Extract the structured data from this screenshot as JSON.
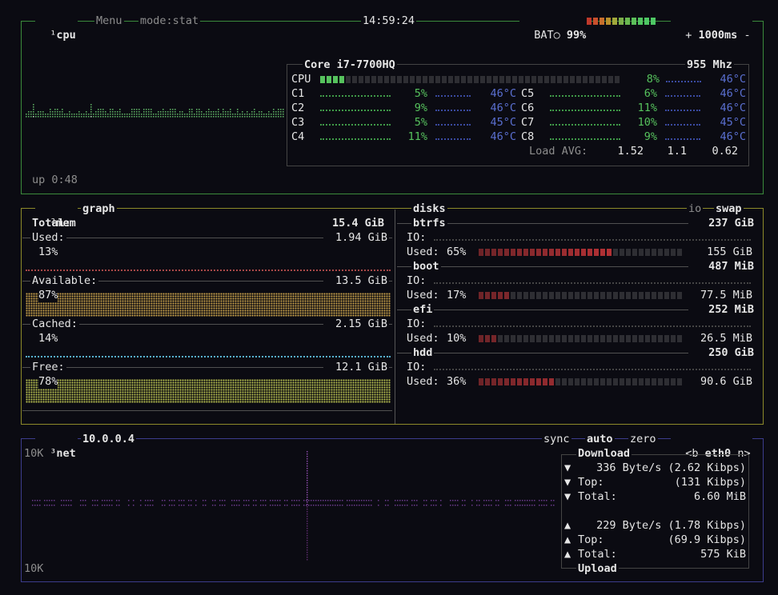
{
  "colors": {
    "cpu_border": "#3b8a3b",
    "mem_border": "#8d8a2a",
    "net_border": "#3c3c8c",
    "cpu_green": "#56c25d",
    "temp_blue": "#5a6fd0",
    "mem_used": "#c05050",
    "mem_avail": "#c8a24a",
    "mem_cached": "#58b0d0",
    "mem_free": "#b8c050",
    "disk_used": "#c0404a",
    "net_graph": "#6a3a8a"
  },
  "cpu": {
    "tab_num": "¹",
    "tab": "cpu",
    "menu": "Menu",
    "mode": "mode:stat",
    "clock": "14:59:24",
    "battery_label": "BAT○",
    "battery_pct": "99%",
    "battery_level": 0.99,
    "plus": "+",
    "interval": "1000ms",
    "minus": "-",
    "uptime": "up 0:48",
    "model": "Core i7-7700HQ",
    "freq": "955 Mhz",
    "total_label": "CPU",
    "total_pct": "8%",
    "total_level": 0.08,
    "total_temp": "46°C",
    "cores": [
      {
        "name": "C1",
        "pct": "5%",
        "temp": "46°C"
      },
      {
        "name": "C2",
        "pct": "9%",
        "temp": "46°C"
      },
      {
        "name": "C3",
        "pct": "5%",
        "temp": "45°C"
      },
      {
        "name": "C4",
        "pct": "11%",
        "temp": "46°C"
      },
      {
        "name": "C5",
        "pct": "6%",
        "temp": "46°C"
      },
      {
        "name": "C6",
        "pct": "11%",
        "temp": "46°C"
      },
      {
        "name": "C7",
        "pct": "10%",
        "temp": "45°C"
      },
      {
        "name": "C8",
        "pct": "9%",
        "temp": "46°C"
      }
    ],
    "load_label": "Load AVG:",
    "load": [
      "1.52",
      "1.1",
      "0.62"
    ]
  },
  "mem": {
    "tab_num": "²",
    "tab": "mem",
    "graph_tab": "graph",
    "total_label": "Total:",
    "total": "15.4 GiB",
    "used_label": "Used:",
    "used": "1.94 GiB",
    "used_pct": "13%",
    "avail_label": "Available:",
    "avail": "13.5 GiB",
    "avail_pct": "87%",
    "cached_label": "Cached:",
    "cached": "2.15 GiB",
    "cached_pct": "14%",
    "free_label": "Free:",
    "free": "12.1 GiB",
    "free_pct": "78%"
  },
  "disks": {
    "tab": "disks",
    "io_tab": "io",
    "swap_tab": "swap",
    "io_label": "IO:",
    "used_label": "Used:",
    "items": [
      {
        "name": "btrfs",
        "size": "237 GiB",
        "used_pct": "65%",
        "used_level": 0.65,
        "used": "155 GiB"
      },
      {
        "name": "boot",
        "size": "487 MiB",
        "used_pct": "17%",
        "used_level": 0.17,
        "used": "77.5 MiB"
      },
      {
        "name": "efi",
        "size": "252 MiB",
        "used_pct": "10%",
        "used_level": 0.1,
        "used": "26.5 MiB"
      },
      {
        "name": "hdd",
        "size": "250 GiB",
        "used_pct": "36%",
        "used_level": 0.36,
        "used": "90.6 GiB"
      }
    ]
  },
  "net": {
    "tab_num": "³",
    "tab": "net",
    "ip": "10.0.0.4",
    "sync": "sync",
    "auto": "auto",
    "zero": "zero",
    "prev": "<b",
    "iface": "eth0",
    "next": "n>",
    "scale_top": "10K",
    "scale_bottom": "10K",
    "download_title": "Download",
    "upload_title": "Upload",
    "down_arrow": "▼",
    "up_arrow": "▲",
    "down_rate": "336 Byte/s (2.62 Kibps)",
    "down_top_label": "Top:",
    "down_top": "(131 Kibps)",
    "down_total_label": "Total:",
    "down_total": "6.60 MiB",
    "up_rate": "229 Byte/s (1.78 Kibps)",
    "up_top_label": "Top:",
    "up_top": "(69.9 Kibps)",
    "up_total_label": "Total:",
    "up_total": "575 KiB"
  }
}
